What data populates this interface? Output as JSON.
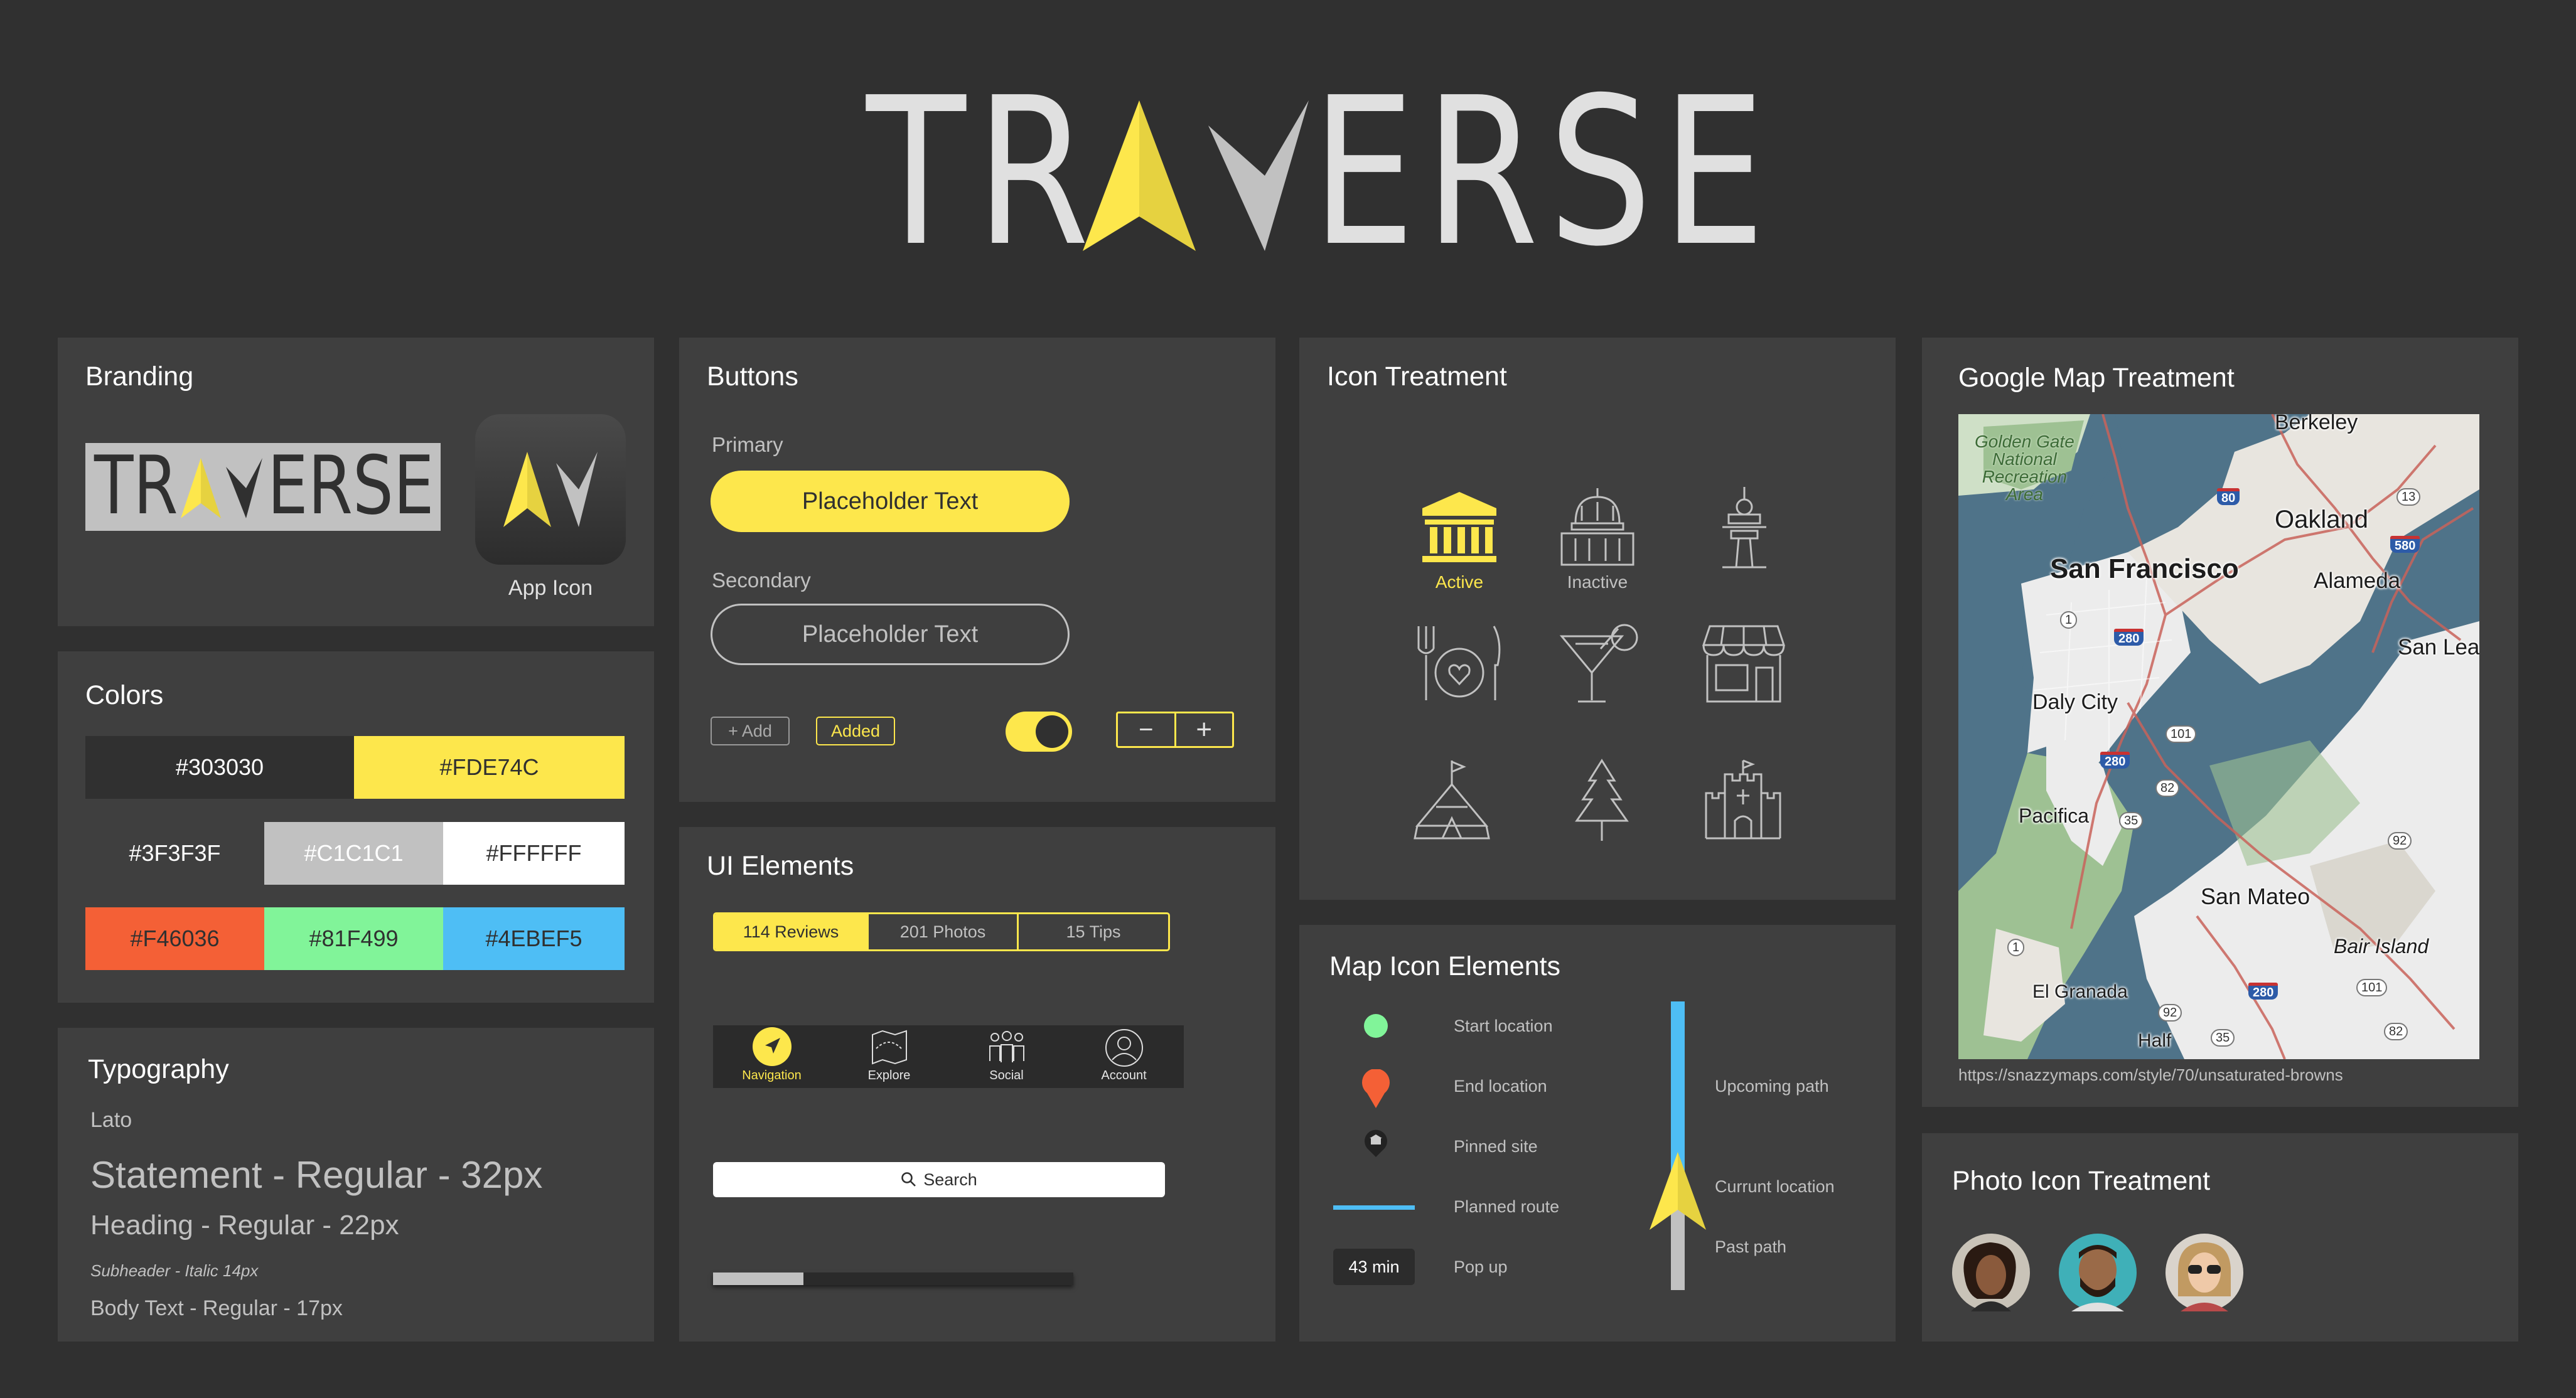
{
  "logo": {
    "part1": "TR",
    "part2": "ERSE"
  },
  "branding": {
    "title": "Branding",
    "logo_small": {
      "part1": "TR",
      "part2": "ERSE"
    },
    "app_icon_label": "App Icon"
  },
  "colors": {
    "title": "Colors",
    "swatches": [
      {
        "label": "#303030",
        "bg": "#303030",
        "fg": "#FFFFFF"
      },
      {
        "label": "#FDE74C",
        "bg": "#FDE74C",
        "fg": "#303030"
      },
      {
        "label": "#3F3F3F",
        "bg": "#3F3F3F",
        "fg": "#FFFFFF"
      },
      {
        "label": "#C1C1C1",
        "bg": "#C1C1C1",
        "fg": "#FFFFFF"
      },
      {
        "label": "#FFFFFF",
        "bg": "#FFFFFF",
        "fg": "#303030"
      },
      {
        "label": "#F46036",
        "bg": "#F46036",
        "fg": "#303030"
      },
      {
        "label": "#81F499",
        "bg": "#81F499",
        "fg": "#303030"
      },
      {
        "label": "#4EBEF5",
        "bg": "#4EBEF5",
        "fg": "#303030"
      }
    ]
  },
  "typography": {
    "title": "Typography",
    "font": "Lato",
    "statement": "Statement - Regular - 32px",
    "heading": "Heading - Regular - 22px",
    "subheader": "Subheader - Italic 14px",
    "body": "Body Text - Regular - 17px"
  },
  "buttons": {
    "title": "Buttons",
    "primary_label": "Primary",
    "primary_button": "Placeholder Text",
    "secondary_label": "Secondary",
    "secondary_button": "Placeholder Text",
    "add_chip": "+ Add",
    "added_chip": "Added",
    "toggle_on": true,
    "stepper_minus": "−",
    "stepper_plus": "+"
  },
  "ui_elements": {
    "title": "UI Elements",
    "tabs": [
      {
        "label": "114 Reviews",
        "active": true
      },
      {
        "label": "201 Photos",
        "active": false
      },
      {
        "label": "15 Tips",
        "active": false
      }
    ],
    "nav": [
      {
        "label": "Navigation",
        "icon": "navigation-arrow-icon",
        "active": true
      },
      {
        "label": "Explore",
        "icon": "map-icon",
        "active": false
      },
      {
        "label": "Social",
        "icon": "people-icon",
        "active": false
      },
      {
        "label": "Account",
        "icon": "account-icon",
        "active": false
      }
    ],
    "search_label": "Search",
    "progress": 0.25
  },
  "icon_treatment": {
    "title": "Icon Treatment",
    "active_label": "Active",
    "inactive_label": "Inactive",
    "icons": [
      "museum-icon",
      "capitol-icon",
      "tower-icon",
      "restaurant-icon",
      "cocktail-icon",
      "shop-icon",
      "tent-icon",
      "tree-icon",
      "castle-icon"
    ]
  },
  "map_icons": {
    "title": "Map Icon Elements",
    "legend": [
      {
        "label": "Start location",
        "icon": "green-dot-icon"
      },
      {
        "label": "End location",
        "icon": "orange-pin-icon"
      },
      {
        "label": "Pinned site",
        "icon": "pinned-site-icon"
      },
      {
        "label": "Planned route",
        "icon": "route-line-icon"
      },
      {
        "label": "Pop up",
        "icon": "popup-icon"
      }
    ],
    "popup_text": "43 min",
    "path_labels": {
      "upcoming": "Upcoming path",
      "current": "Currunt location",
      "past": "Past path"
    }
  },
  "map": {
    "title": "Google Map Treatment",
    "url": "https://snazzymaps.com/style/70/unsaturated-browns",
    "labels": {
      "golden_gate": "Golden Gate\nNational\nRecreation\nArea",
      "berkeley": "Berkeley",
      "oakland": "Oakland",
      "san_francisco": "San Francisco",
      "alameda": "Alameda",
      "san_lea": "San Lea",
      "daly_city": "Daly City",
      "pacifica": "Pacifica",
      "san_mateo": "San Mateo",
      "bair_island": "Bair Island",
      "el_granada": "El Granada",
      "half": "Half"
    },
    "shields": {
      "r80": "80",
      "r13": "13",
      "r580": "580",
      "r1a": "1",
      "r280a": "280",
      "r101a": "101",
      "r280b": "280",
      "r82a": "82",
      "r35a": "35",
      "r92a": "92",
      "r1b": "1",
      "r280c": "280",
      "r101b": "101",
      "r92b": "92",
      "r35b": "35",
      "r82b": "82"
    }
  },
  "photo_icons": {
    "title": "Photo Icon Treatment"
  }
}
